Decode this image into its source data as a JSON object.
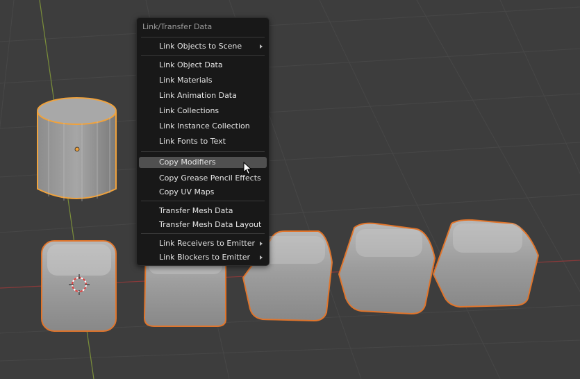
{
  "menu": {
    "title": "Link/Transfer Data",
    "items": [
      {
        "label": "Link Objects to Scene",
        "submenu": true
      },
      {
        "label": "Link Object Data"
      },
      {
        "label": "Link Materials"
      },
      {
        "label": "Link Animation Data"
      },
      {
        "label": "Link Collections"
      },
      {
        "label": "Link Instance Collection"
      },
      {
        "label": "Link Fonts to Text"
      },
      {
        "label": "Copy Modifiers",
        "active": true
      },
      {
        "label": "Copy Grease Pencil Effects"
      },
      {
        "label": "Copy UV Maps"
      },
      {
        "label": "Transfer Mesh Data"
      },
      {
        "label": "Transfer Mesh Data Layout"
      },
      {
        "label": "Link Receivers to Emitter",
        "submenu": true
      },
      {
        "label": "Link Blockers to Emitter",
        "submenu": true
      }
    ]
  },
  "colors": {
    "viewport_bg": "#3d3d3d",
    "selection_outline": "#e0752c",
    "active_outline": "#f0a23c",
    "menu_bg": "#181818",
    "menu_highlight": "#505050"
  },
  "icons": [
    "submenu-arrow-icon",
    "mouse-cursor-icon",
    "3d-cursor-icon",
    "origin-point-icon"
  ]
}
